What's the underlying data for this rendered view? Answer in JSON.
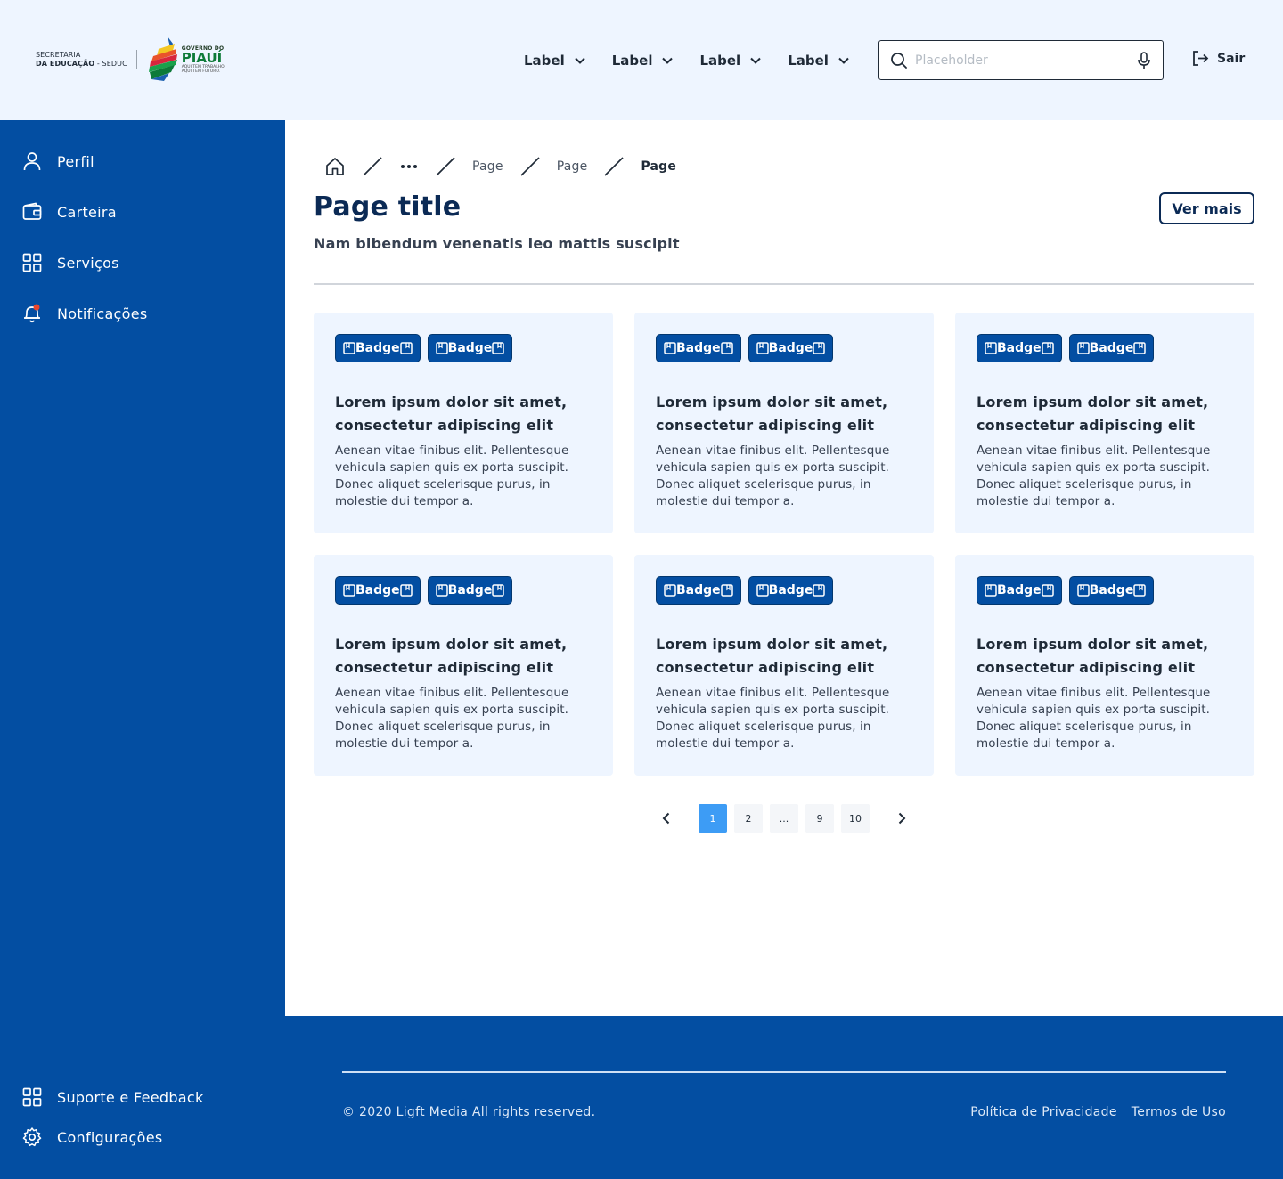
{
  "header": {
    "logo": {
      "secretaria_line1": "SECRETARIA",
      "secretaria_line2_bold": "DA EDUCAÇÃO",
      "secretaria_line2_rest": " - SEDUC",
      "gov_line1": "GOVERNO DO",
      "gov_line2": "PIAUÍ",
      "gov_line3": "AQUI TEM TRABALHO",
      "gov_line4": "AQUI TEM FUTURO."
    },
    "nav": [
      "Label",
      "Label",
      "Label",
      "Label"
    ],
    "search": {
      "placeholder": "Placeholder",
      "value": ""
    },
    "logout_label": "Sair"
  },
  "sidebar": {
    "items": [
      {
        "label": "Perfil",
        "icon": "user-icon"
      },
      {
        "label": "Carteira",
        "icon": "wallet-icon"
      },
      {
        "label": "Serviços",
        "icon": "grid-icon"
      },
      {
        "label": "Notificações",
        "icon": "bell-icon"
      }
    ],
    "bottom_items": [
      {
        "label": "Suporte e Feedback",
        "icon": "grid-icon"
      },
      {
        "label": "Configurações",
        "icon": "gear-icon"
      }
    ]
  },
  "main": {
    "breadcrumb": [
      "Page",
      "Page",
      "Page"
    ],
    "title": "Page title",
    "subtitle": "Nam bibendum venenatis leo mattis suscipit",
    "more_button": "Ver mais",
    "cards": [
      {
        "badges": [
          "Badge",
          "Badge"
        ],
        "title": "Lorem ipsum dolor sit amet, consectetur adipiscing elit",
        "text": "Aenean vitae finibus elit. Pellentesque vehicula sapien quis ex porta suscipit. Donec aliquet scelerisque purus, in molestie dui tempor a."
      },
      {
        "badges": [
          "Badge",
          "Badge"
        ],
        "title": "Lorem ipsum dolor sit amet, consectetur adipiscing elit",
        "text": "Aenean vitae finibus elit. Pellentesque vehicula sapien quis ex porta suscipit. Donec aliquet scelerisque purus, in molestie dui tempor a."
      },
      {
        "badges": [
          "Badge",
          "Badge"
        ],
        "title": "Lorem ipsum dolor sit amet, consectetur adipiscing elit",
        "text": "Aenean vitae finibus elit. Pellentesque vehicula sapien quis ex porta suscipit. Donec aliquet scelerisque purus, in molestie dui tempor a."
      },
      {
        "badges": [
          "Badge",
          "Badge"
        ],
        "title": "Lorem ipsum dolor sit amet, consectetur adipiscing elit",
        "text": "Aenean vitae finibus elit. Pellentesque vehicula sapien quis ex porta suscipit. Donec aliquet scelerisque purus, in molestie dui tempor a."
      },
      {
        "badges": [
          "Badge",
          "Badge"
        ],
        "title": "Lorem ipsum dolor sit amet, consectetur adipiscing elit",
        "text": "Aenean vitae finibus elit. Pellentesque vehicula sapien quis ex porta suscipit. Donec aliquet scelerisque purus, in molestie dui tempor a."
      },
      {
        "badges": [
          "Badge",
          "Badge"
        ],
        "title": "Lorem ipsum dolor sit amet, consectetur adipiscing elit",
        "text": "Aenean vitae finibus elit. Pellentesque vehicula sapien quis ex porta suscipit. Donec aliquet scelerisque purus, in molestie dui tempor a."
      }
    ],
    "pagination": {
      "pages": [
        "1",
        "2",
        "...",
        "9",
        "10"
      ],
      "current": "1"
    }
  },
  "footer": {
    "copyright": "© 2020 Ligft Media All rights reserved.",
    "links": [
      "Política de Privacidade",
      "Termos de Uso"
    ]
  },
  "colors": {
    "primary": "#034ea2",
    "header_bg": "#eef5ff",
    "card_bg": "#eef5ff",
    "title": "#0b2a55",
    "pagination_active": "#3d9cf5",
    "notification_dot": "#e8452c"
  }
}
